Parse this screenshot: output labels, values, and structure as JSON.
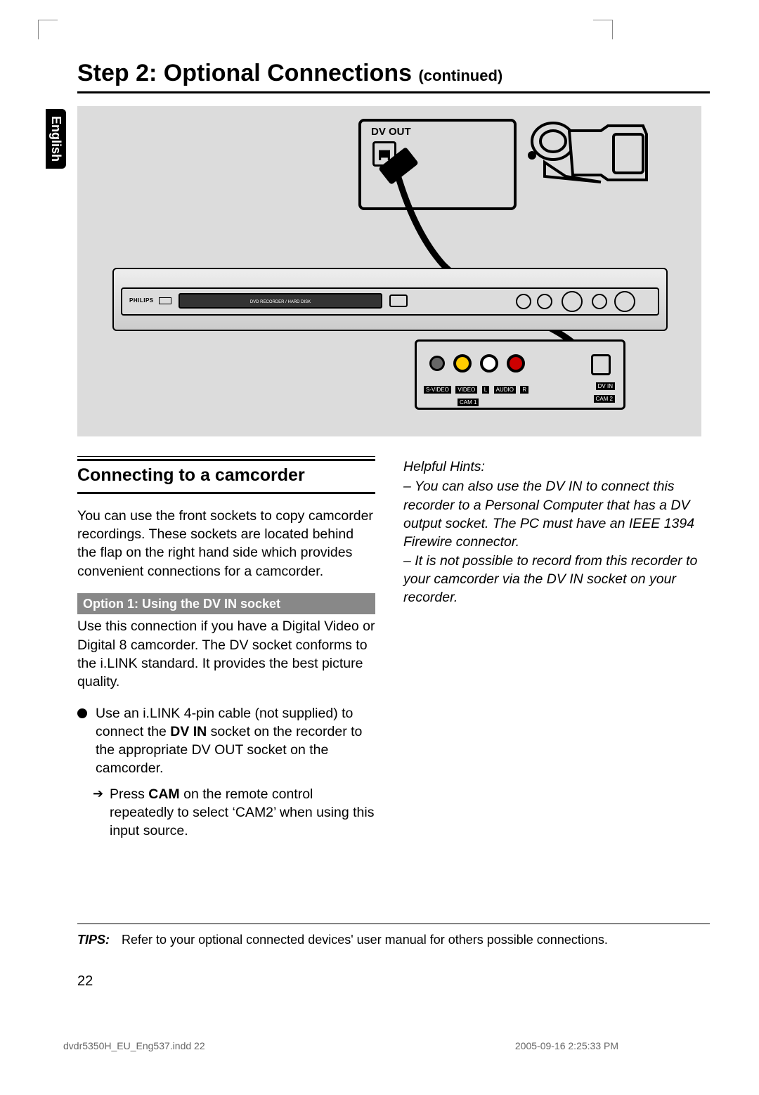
{
  "language_tab": "English",
  "title_main": "Step 2: Optional Connections ",
  "title_suffix": "(continued)",
  "diagram": {
    "dv_out": "DV OUT",
    "brand": "PHILIPS",
    "tray_label": "DVD RECORDER / HARD DISK",
    "labels": {
      "svideo": "S-VIDEO",
      "video": "VIDEO",
      "l": "L",
      "audio": "AUDIO",
      "r": "R",
      "cam1": "CAM 1",
      "dvin": "DV IN",
      "cam2": "CAM 2"
    }
  },
  "left_col": {
    "subhead": "Connecting to a camcorder",
    "intro": "You can use the front sockets to copy camcorder recordings. These sockets are located behind the flap on the right hand side which provides convenient connections for a camcorder.",
    "option_bar": "Option 1: Using the DV IN socket",
    "option_para": "Use this connection if you have a Digital Video or Digital 8 camcorder. The DV socket conforms to the i.LINK standard. It provides the best picture quality.",
    "bullet_pre": "Use an i.LINK 4-pin cable (not supplied) to connect the ",
    "bullet_bold": "DV IN",
    "bullet_post": " socket on the recorder to the appropriate DV OUT socket on the camcorder.",
    "arrow_pre": "Press ",
    "arrow_bold": "CAM",
    "arrow_post": " on the remote control repeatedly to select ‘CAM2’ when using this input source."
  },
  "right_col": {
    "hints_title": "Helpful Hints:",
    "hint1": "– You can also use the DV IN to connect this recorder to a Personal Computer that has a DV output socket. The PC must have an IEEE 1394 Firewire connector.",
    "hint2": "– It is not possible to record from this recorder to your camcorder via the DV IN socket on your recorder."
  },
  "tips": {
    "label": "TIPS:",
    "text": "Refer to your optional connected devices' user manual for others possible connections."
  },
  "page_number": "22",
  "footer": {
    "file": "dvdr5350H_EU_Eng537.indd   22",
    "timestamp": "2005-09-16   2:25:33 PM"
  }
}
